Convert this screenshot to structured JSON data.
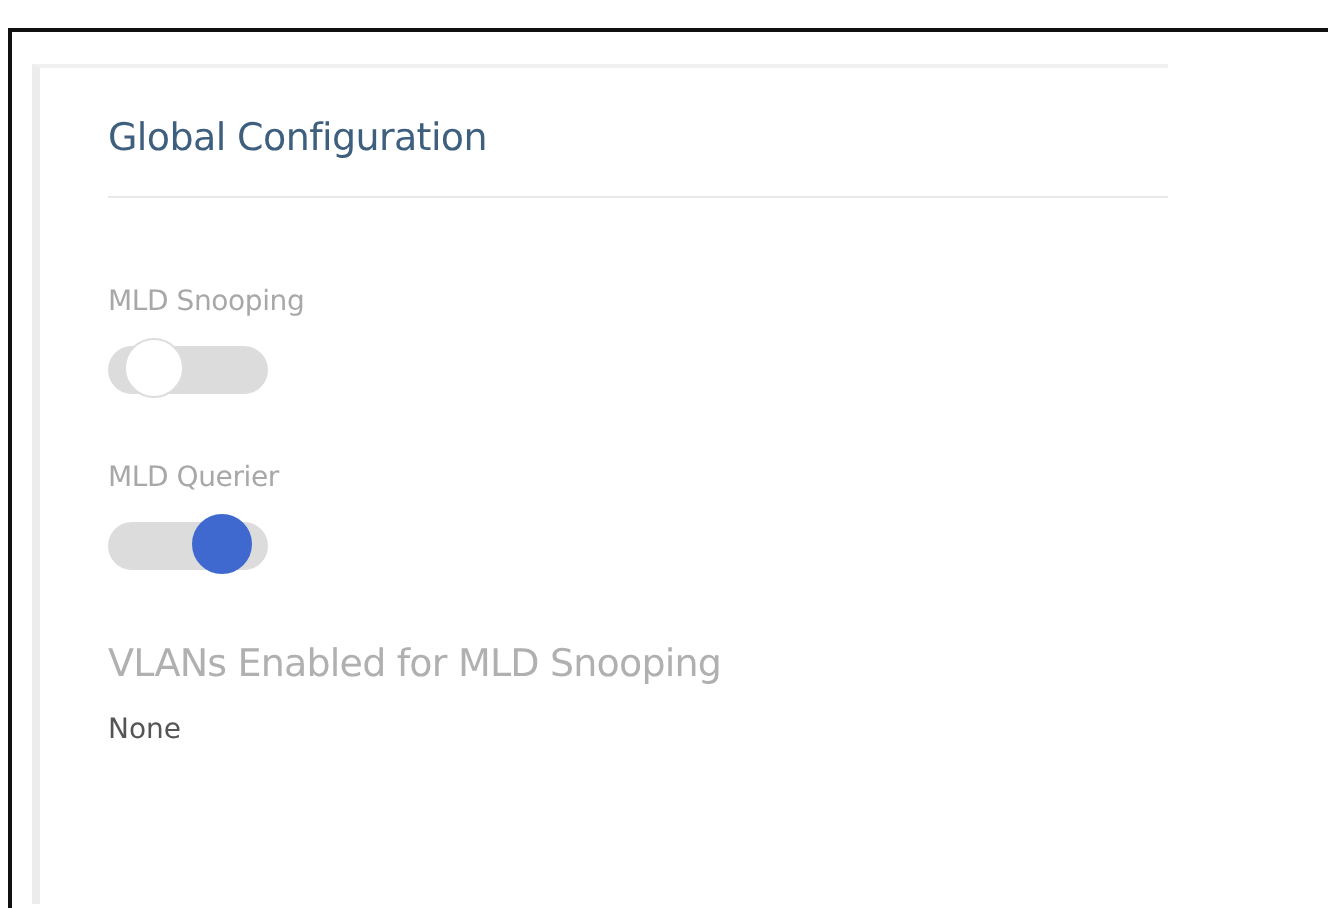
{
  "panel": {
    "title": "Global Configuration",
    "settings": [
      {
        "kind": "toggle",
        "label": "MLD Snooping",
        "on": false
      },
      {
        "kind": "toggle",
        "label": "MLD Querier",
        "on": true
      },
      {
        "kind": "value",
        "label": "VLANs Enabled for MLD Snooping",
        "value": "None"
      }
    ]
  }
}
